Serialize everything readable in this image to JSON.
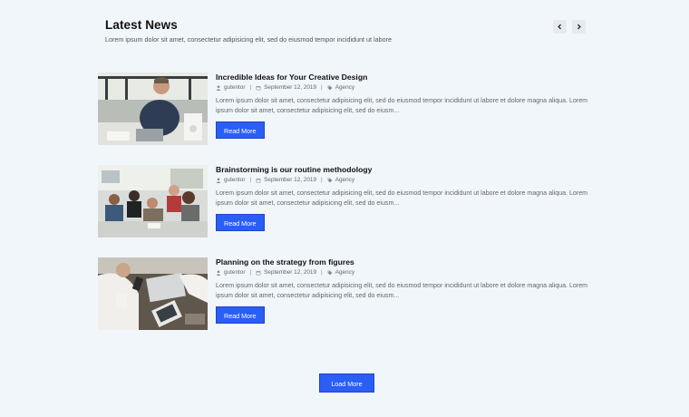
{
  "header": {
    "title": "Latest News",
    "subtitle": "Lorem ipsum dolor sit amet, consectetur adipisicing elit, sed do eiusmod tempor incididunt ut labore"
  },
  "nav": {
    "prev_icon": "chevron-left-icon",
    "next_icon": "chevron-right-icon"
  },
  "posts": [
    {
      "title": "Incredible Ideas for Your Creative Design",
      "author": "gutentor",
      "date": "September 12, 2019",
      "category": "Agency",
      "excerpt": "Lorem ipsum dolor sit amet, consectetur adipisicing elit, sed do eiusmod tempor incididunt ut labore et dolore magna aliqua. Lorem ipsum dolor sit amet, consectetur adipisicing elit, sed do eiusm...",
      "button": "Read More"
    },
    {
      "title": "Brainstorming is our routine methodology",
      "author": "gutentor",
      "date": "September 12, 2019",
      "category": "Agency",
      "excerpt": "Lorem ipsum dolor sit amet, consectetur adipisicing elit, sed do eiusmod tempor incididunt ut labore et dolore magna aliqua. Lorem ipsum dolor sit amet, consectetur adipisicing elit, sed do eiusm...",
      "button": "Read More"
    },
    {
      "title": "Planning on the strategy from figures",
      "author": "gutentor",
      "date": "September 12, 2019",
      "category": "Agency",
      "excerpt": "Lorem ipsum dolor sit amet, consectetur adipisicing elit, sed do eiusmod tempor incididunt ut labore et dolore magna aliqua. Lorem ipsum dolor sit amet, consectetur adipisicing elit, sed do eiusm...",
      "button": "Read More"
    }
  ],
  "load_more": "Load More",
  "colors": {
    "accent": "#2a5ef5",
    "background": "#f1f6fb"
  }
}
